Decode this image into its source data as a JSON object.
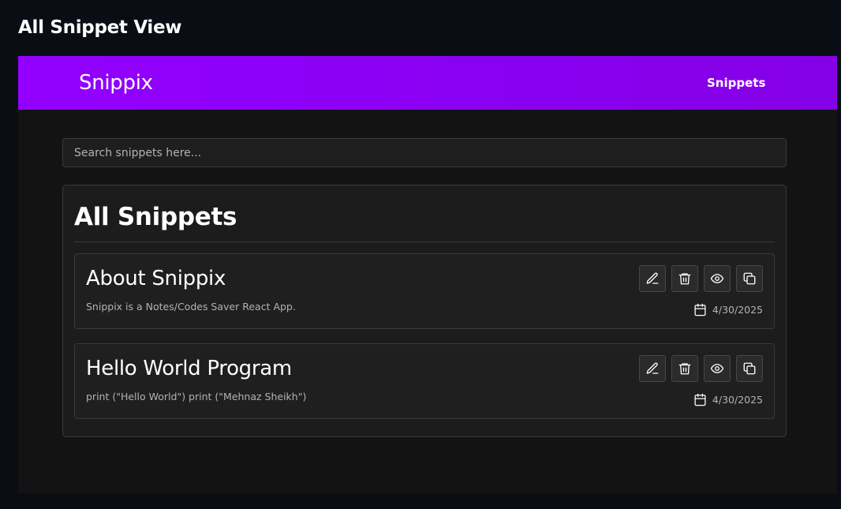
{
  "page": {
    "title": "All Snippet View"
  },
  "navbar": {
    "brand": "Snippix",
    "link_snippets": "Snippets",
    "gradient_colors": [
      "#9300ff",
      "#8400e6"
    ]
  },
  "search": {
    "placeholder": "Search snippets here...",
    "value": ""
  },
  "panel": {
    "heading": "All Snippets"
  },
  "snippets": [
    {
      "title": "About Snippix",
      "content": "Snippix is a Notes/Codes Saver React App.",
      "date": "4/30/2025"
    },
    {
      "title": "Hello World Program",
      "content": "print (\"Hello World\") print (\"Mehnaz Sheikh\")",
      "date": "4/30/2025"
    }
  ],
  "icons": {
    "edit": "pencil-icon",
    "delete": "trash-icon",
    "view": "eye-icon",
    "copy": "copy-icon",
    "date": "calendar-icon"
  }
}
